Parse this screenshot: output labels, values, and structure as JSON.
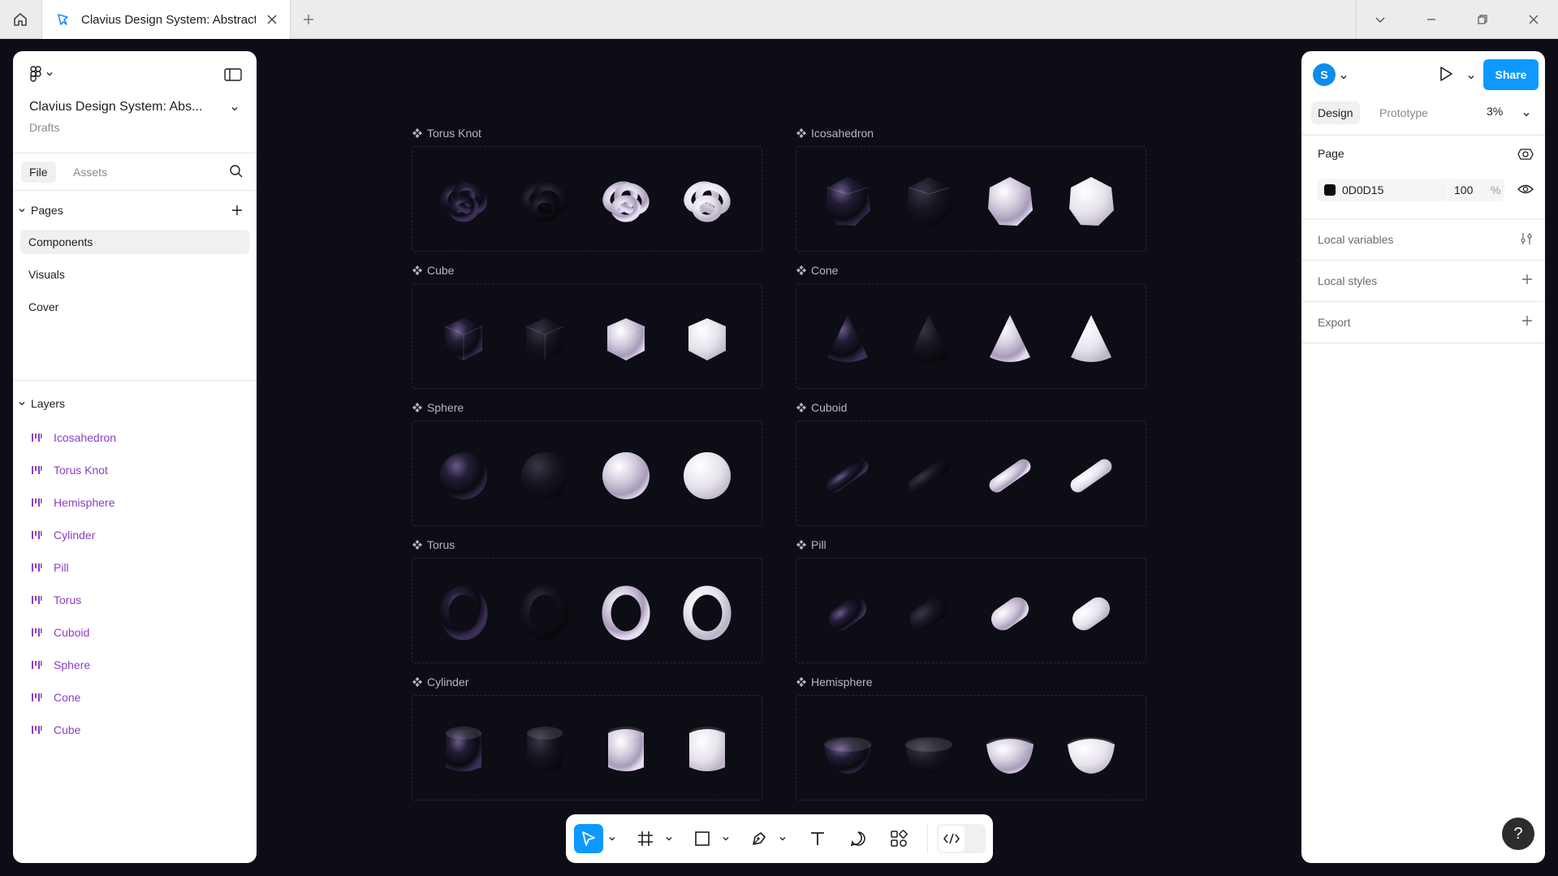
{
  "browser": {
    "tab_title": "Clavius Design System: Abstract",
    "new_tab_icon": "plus-icon"
  },
  "file": {
    "name": "Clavius Design System: Abs...",
    "location": "Drafts"
  },
  "left_panel": {
    "tabs": {
      "file": "File",
      "assets": "Assets"
    },
    "pages_heading": "Pages",
    "pages": [
      "Components",
      "Visuals",
      "Cover"
    ],
    "active_page": "Components",
    "layers_heading": "Layers",
    "layers": [
      "Icosahedron",
      "Torus Knot",
      "Hemisphere",
      "Cylinder",
      "Pill",
      "Torus",
      "Cuboid",
      "Sphere",
      "Cone",
      "Cube"
    ]
  },
  "right_panel": {
    "avatar_initial": "S",
    "share_label": "Share",
    "tabs": {
      "design": "Design",
      "prototype": "Prototype"
    },
    "zoom": "3%",
    "page_heading": "Page",
    "page_color_hex": "0D0D15",
    "page_opacity": "100",
    "percent_sign": "%",
    "local_variables": "Local variables",
    "local_styles": "Local styles",
    "export": "Export",
    "help": "?"
  },
  "canvas": {
    "background": "#0d0d15",
    "components": [
      {
        "name": "Torus Knot"
      },
      {
        "name": "Icosahedron"
      },
      {
        "name": "Cube"
      },
      {
        "name": "Cone"
      },
      {
        "name": "Sphere"
      },
      {
        "name": "Cuboid"
      },
      {
        "name": "Torus"
      },
      {
        "name": "Pill"
      },
      {
        "name": "Cylinder"
      },
      {
        "name": "Hemisphere"
      }
    ],
    "variants_per_component": 4,
    "variant_styles": [
      "dark-iridescent",
      "dark-matte",
      "light-iridescent",
      "light-matte"
    ]
  },
  "toolbar": {
    "tools": [
      "move-tool",
      "frame-tool",
      "shape-tool",
      "pen-tool",
      "text-tool",
      "comment-tool",
      "actions-tool",
      "dev-mode-toggle"
    ],
    "active_tool": "move-tool"
  },
  "colors": {
    "accent": "#0d99ff",
    "layer_purple": "#8b3ec6",
    "canvas": "#0d0d15"
  }
}
